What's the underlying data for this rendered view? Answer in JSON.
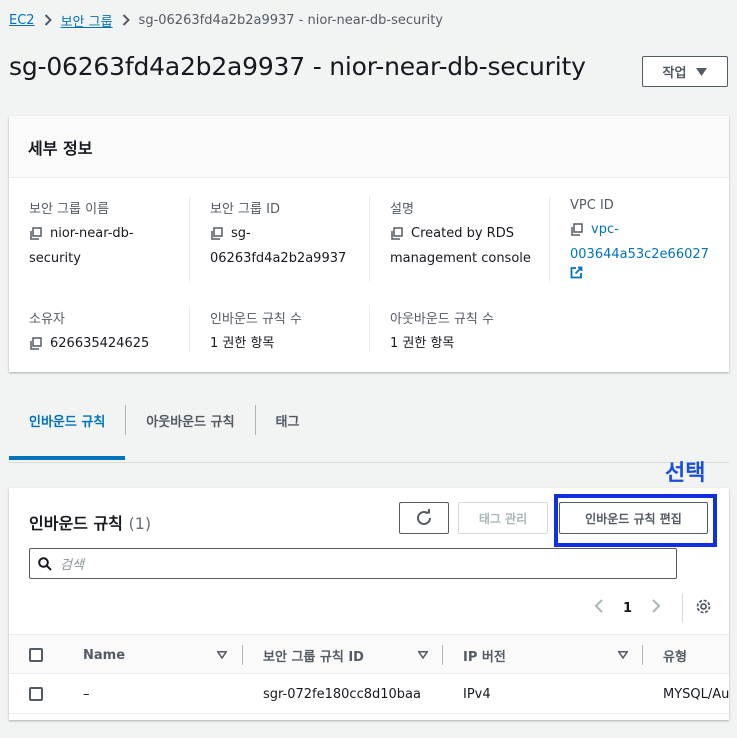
{
  "breadcrumb": {
    "ec2": "EC2",
    "security_groups": "보안 그룹",
    "current": "sg-06263fd4a2b2a9937 - nior-near-db-security"
  },
  "page": {
    "title": "sg-06263fd4a2b2a9937 - nior-near-db-security",
    "actions_label": "작업"
  },
  "details": {
    "header": "세부 정보",
    "sg_name_label": "보안 그룹 이름",
    "sg_name_line1": "nior-near-db-",
    "sg_name_line2": "security",
    "sg_id_label": "보안 그룹 ID",
    "sg_id_line1": "sg-",
    "sg_id_line2": "06263fd4a2b2a9937",
    "desc_label": "설명",
    "desc_line1": "Created by RDS",
    "desc_line2": "management console",
    "vpc_label": "VPC ID",
    "vpc_line1": "vpc-",
    "vpc_line2": "003644a53c2e66027",
    "owner_label": "소유자",
    "owner_value": "626635424625",
    "inbound_count_label": "인바운드 규칙 수",
    "inbound_count_value": "1 권한 항목",
    "outbound_count_label": "아웃바운드 규칙 수",
    "outbound_count_value": "1 권한 항목"
  },
  "tabs": {
    "inbound": "인바운드 규칙",
    "outbound": "아웃바운드 규칙",
    "tags": "태그"
  },
  "annotation": "선택",
  "rules": {
    "title": "인바운드 규칙",
    "count": "(1)",
    "manage_tags": "태그 관리",
    "edit_inbound": "인바운드 규칙 편집",
    "search_placeholder": "검색",
    "page": "1",
    "columns": {
      "name": "Name",
      "rule_id": "보안 그룹 규칙 ID",
      "ip_version": "IP 버전",
      "type": "유형"
    },
    "row": {
      "name": "–",
      "rule_id": "sgr-072fe180cc8d10baa",
      "ip_version": "IPv4",
      "type": "MYSQL/Au"
    }
  },
  "colors": {
    "link": "#0073bb",
    "annotation": "#1a4dd8",
    "highlight": "#1030e0"
  }
}
